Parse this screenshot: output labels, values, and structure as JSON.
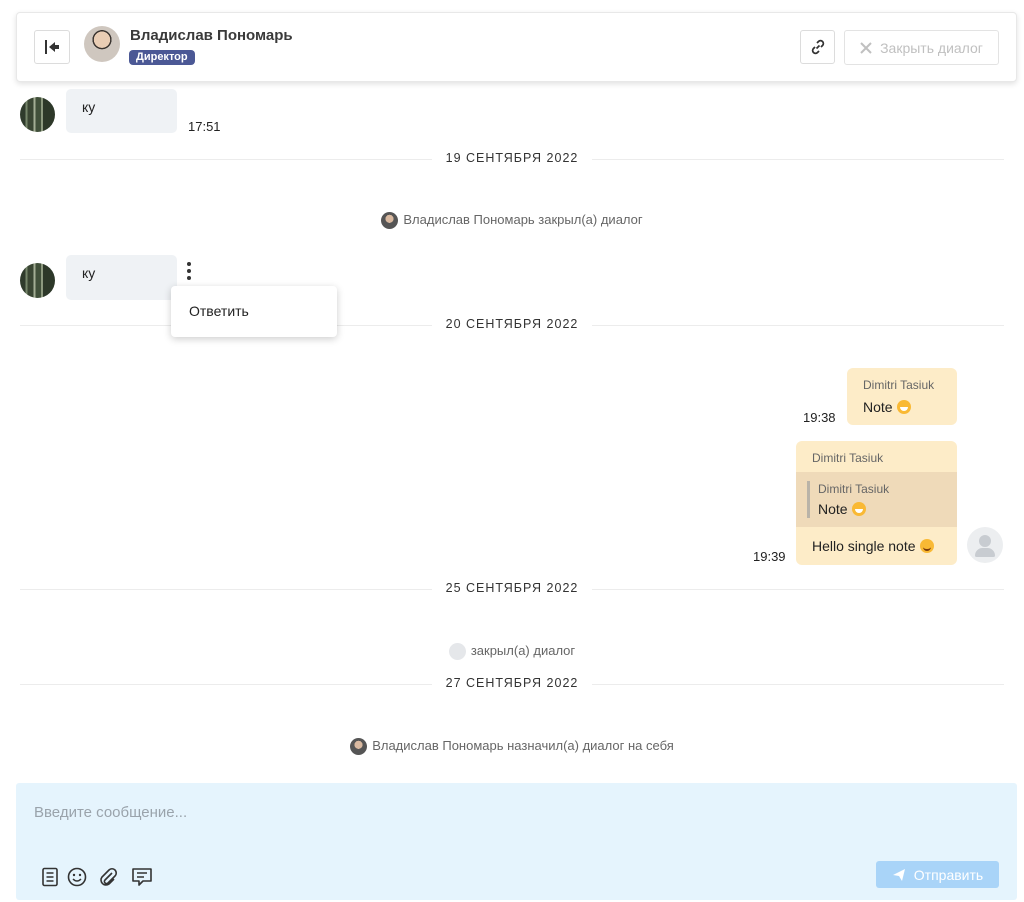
{
  "header": {
    "user_name": "Владислав Пономарь",
    "role_badge": "Директор",
    "close_label": "Закрыть диалог",
    "icons": {
      "back": "exit-left-icon",
      "link": "link-icon",
      "close": "close-x-icon"
    }
  },
  "messages": [
    {
      "type": "incoming",
      "text": "ку",
      "time": "17:51"
    },
    {
      "type": "incoming",
      "text": "ку"
    }
  ],
  "dates": [
    "19 СЕНТЯБРЯ 2022",
    "20 СЕНТЯБРЯ 2022",
    "25 СЕНТЯБРЯ 2022",
    "27 СЕНТЯБРЯ 2022"
  ],
  "system_events": [
    "Владислав Пономарь закрыл(а) диалог",
    "закрыл(а) диалог",
    "Владислав Пономарь назначил(а) диалог на себя"
  ],
  "context_menu": {
    "reply_label": "Ответить"
  },
  "notes": [
    {
      "author": "Dimitri Tasiuk",
      "text": "Note",
      "emoji": "grinning-face-icon",
      "time": "19:38"
    },
    {
      "author": "Dimitri Tasiuk",
      "quote_author": "Dimitri Tasiuk",
      "quote_text": "Note",
      "text": "Hello single note",
      "emoji": "smiling-face-icon",
      "time": "19:39"
    }
  ],
  "composer": {
    "placeholder": "Введите сообщение...",
    "send_label": "Отправить",
    "tools": [
      "template-icon",
      "emoji-icon",
      "attach-icon",
      "note-icon"
    ]
  },
  "colors": {
    "accent": "#4b5895",
    "note_bg": "#fdecc8",
    "composer_bg": "#e5f4fd",
    "send_btn": "#a9d4f8"
  }
}
